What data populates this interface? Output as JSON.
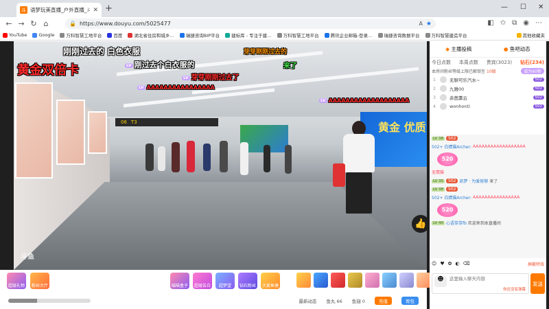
{
  "browser": {
    "tab_title": "语梦玩美直播_户外直播_斗…",
    "url": "https://www.douyu.com/5025477",
    "bookmarks": [
      "YouTube",
      "Google",
      "万科智慧工地平台",
      "百度",
      "湖北省住房和城乡…",
      "瑞捷咨询BIP平台",
      "建标库 - 专注于建…",
      "万科智慧工地平台",
      "腾讯企业邮箱-登录…",
      "瑞捷咨询数据平台",
      "万科智慧建造平台",
      "其他收藏夹"
    ]
  },
  "stream": {
    "captions": {
      "top_white": "刚刚过去的 白色衣服",
      "big_red": "黄金双倍卡",
      "white_2": "刚过去个白衣服的",
      "orange_top": "芽芽刚刚过去的",
      "green": "来了",
      "red_3": "芽芽刚刚过去了",
      "aaa_1": "AAAAAAAAAAAAAAAA",
      "aaa_2": "AAAAAAAAAAAAAAAAAAA"
    },
    "gate_sign": "T3",
    "gate_num": "06",
    "board_text": "黄金 优质",
    "watermark": "斗鱼"
  },
  "panel": {
    "header": {
      "rank": "主播投稿",
      "rank2": "鱼吧动态"
    },
    "tabs": {
      "today": "今日点数",
      "week": "本周点数",
      "noble": "贵宾(3023)",
      "diamond": "钻石(234)"
    },
    "notice": {
      "text": "本房间粉丝等级上限已解锁至",
      "level": "10级",
      "btn": "成为60粉"
    },
    "ranks": [
      {
        "num": "1",
        "name": "无聊可乐汽水~",
        "badge": "502"
      },
      {
        "num": "2",
        "name": "九雅00",
        "badge": "502"
      },
      {
        "num": "3",
        "name": "赤茜薰云",
        "badge": "502"
      },
      {
        "num": "4",
        "name": "wonhonti",
        "badge": "502"
      }
    ],
    "chat": [
      {
        "lvl": "LV 38",
        "badge": "502",
        "user": "",
        "text": ""
      },
      {
        "lvl": "",
        "badge": "",
        "user": "502+ 白嫖猫Archer:",
        "text": "AAAAAAAAAAAAAAAAAA"
      },
      {
        "lvl": "",
        "badge": "",
        "user": "",
        "text": "",
        "gift": "520"
      },
      {
        "lvl": "",
        "badge": "",
        "user": "无情猫",
        "text": ""
      },
      {
        "lvl": "LV 35",
        "badge": "502",
        "user": "凯梦",
        "text": "· 为爱就够",
        "suffix": "来了"
      },
      {
        "lvl": "LV 38",
        "badge": "502",
        "user": "",
        "text": ""
      },
      {
        "lvl": "",
        "badge": "",
        "user": "502+ 白嫖猫Archer:",
        "text": "AAAAAAAAAAAAAAAA"
      },
      {
        "lvl": "",
        "badge": "",
        "user": "",
        "text": "",
        "gift": "520"
      },
      {
        "lvl": "LV 40",
        "badge": "",
        "user": "心语芽芽fb",
        "text": "欢迎来到本直播间"
      }
    ],
    "foot_lock": "屏蔽特效",
    "input_placeholder": "这里输入聊天内容",
    "input_hint": "你还没有弹幕",
    "send": "发送"
  },
  "giftbar": {
    "left_items": [
      "超级礼物",
      "粉丝大厅"
    ],
    "mid_items": [
      "喵喵盒子",
      "超级告白",
      "超梦望",
      "钻石粉丝",
      "大爱鱼塘"
    ],
    "bottom": {
      "level": "最新动态",
      "fish": "鱼丸 66",
      "bamboo": "鱼翅 0",
      "charge": "充值",
      "pack": "背包"
    }
  }
}
